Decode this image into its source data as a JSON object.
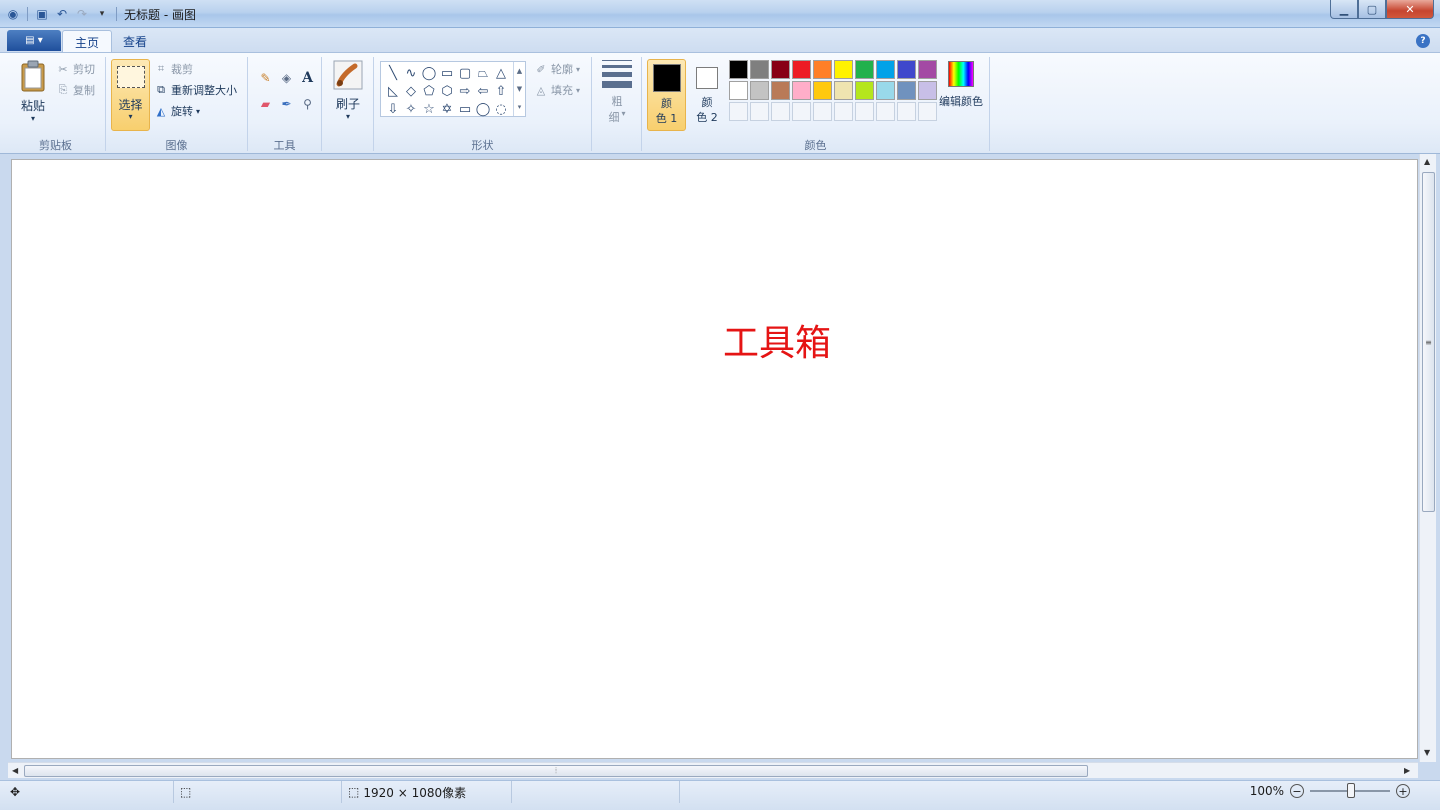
{
  "window": {
    "title": "无标题 - 画图",
    "qat": [
      "save-icon",
      "undo-icon",
      "redo-icon",
      "customize-icon"
    ]
  },
  "tabs": [
    {
      "label": "主页"
    },
    {
      "label": "查看"
    }
  ],
  "ribbon": {
    "clipboard": {
      "group": "剪贴板",
      "paste": "粘贴",
      "cut": "剪切",
      "copy": "复制"
    },
    "image": {
      "group": "图像",
      "select": "选择",
      "crop": "裁剪",
      "resize": "重新调整大小",
      "rotate": "旋转"
    },
    "tools": {
      "group": "工具"
    },
    "brushes": {
      "label": "刷子"
    },
    "shapes": {
      "group": "形状",
      "outline": "轮廓",
      "fill": "填充"
    },
    "size": {
      "label1": "粗",
      "label2": "细"
    },
    "colors": {
      "group": "颜色",
      "color1_line1": "颜",
      "color1_line2": "色 1",
      "color2_line1": "颜",
      "color2_line2": "色 2",
      "color1": "#000000",
      "color2": "#ffffff",
      "edit": "编辑颜色",
      "palette_row1": [
        "#000000",
        "#7f7f7f",
        "#880015",
        "#ed1c24",
        "#ff7f27",
        "#fff200",
        "#22b14c",
        "#00a2e8",
        "#3f48cc",
        "#a349a4"
      ],
      "palette_row2": [
        "#ffffff",
        "#c3c3c3",
        "#b97a57",
        "#ffaec9",
        "#ffc90e",
        "#efe4b0",
        "#b5e61d",
        "#99d9ea",
        "#7092be",
        "#c8bfe7"
      ]
    }
  },
  "canvas": {
    "text": "工具箱",
    "text_color": "#e51414"
  },
  "status": {
    "size": "1920 × 1080像素",
    "zoom": "100%"
  }
}
